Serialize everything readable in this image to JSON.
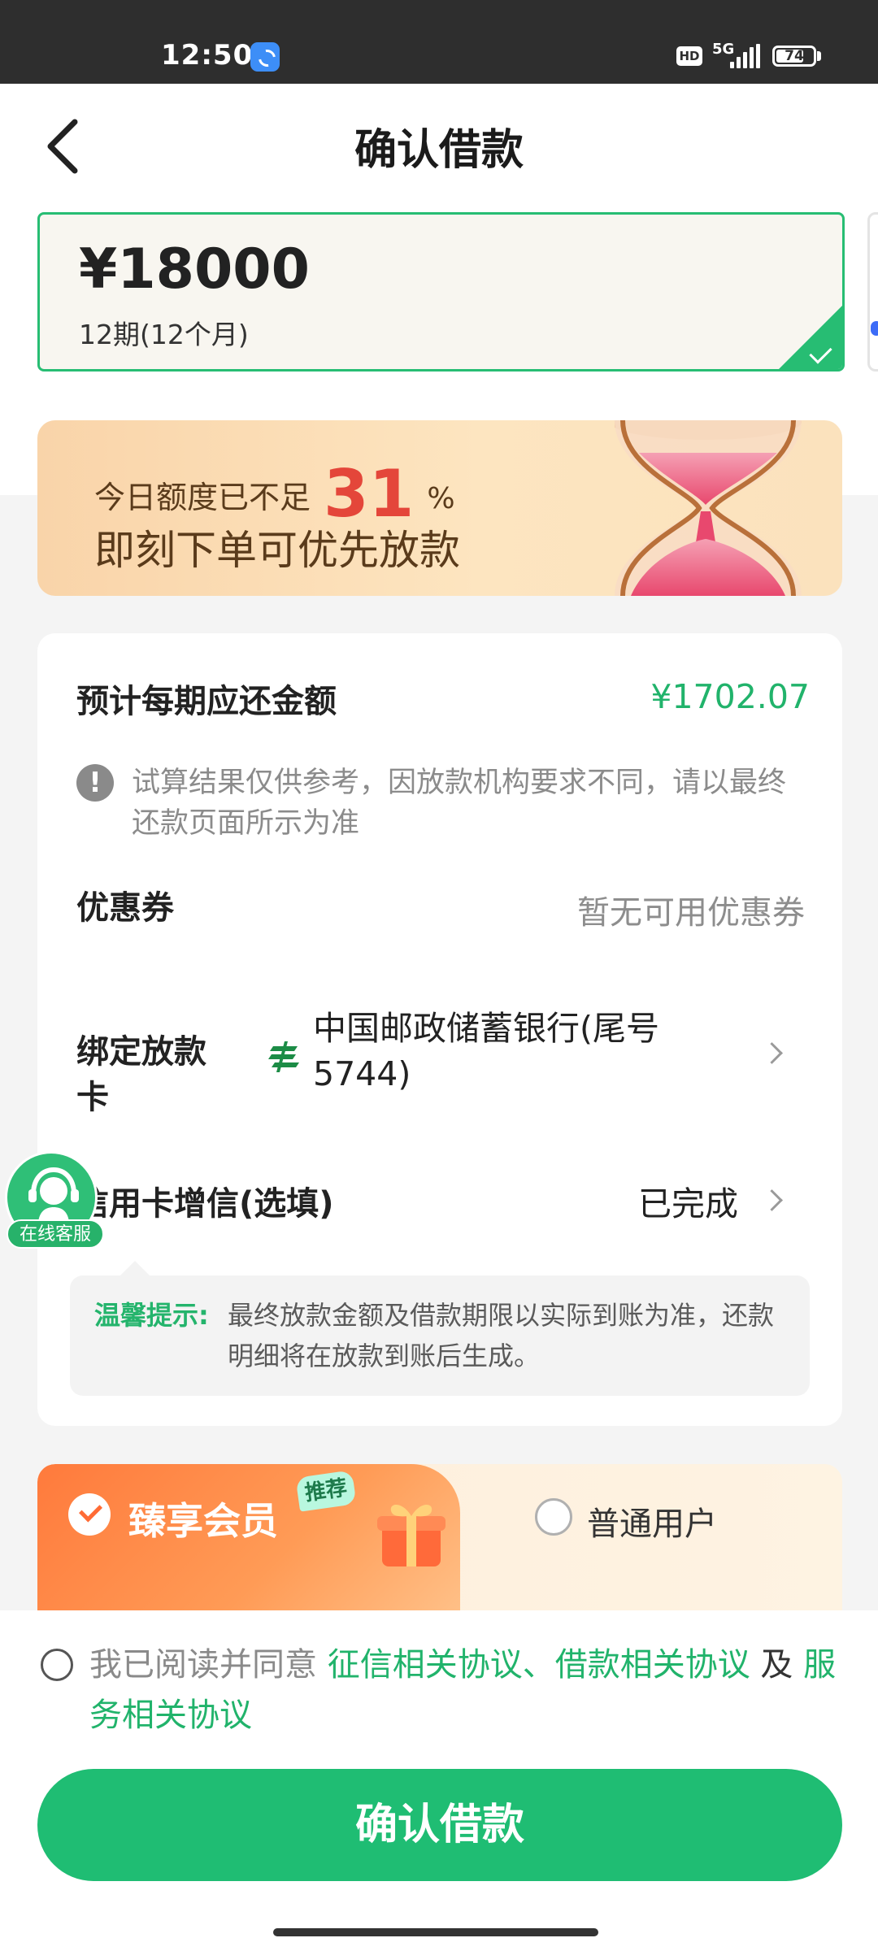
{
  "status_bar": {
    "time": "12:50",
    "network": "5G",
    "hd_label": "HD",
    "battery": "74",
    "battery_level": 0.74
  },
  "header": {
    "title": "确认借款"
  },
  "loan_option": {
    "amount": "¥18000",
    "term": "12期(12个月)"
  },
  "promo": {
    "prefix": "今日额度已不足",
    "percent_value": "31",
    "percent_sign": "%",
    "line2": "即刻下单可优先放款"
  },
  "details": {
    "repay_label": "预计每期应还金额",
    "repay_amount": "¥1702.07",
    "note": "试算结果仅供参考，因放款机构要求不同，请以最终还款页面所示为准",
    "coupon_label": "优惠券",
    "coupon_value": "暂无可用优惠券",
    "bank_label": "绑定放款卡",
    "bank_name": "中国邮政储蓄银行(尾号5744)",
    "credit_label": "信用卡增信(选填)",
    "credit_status": "已完成",
    "tips_label": "温馨提示:",
    "tips_text": "最终放款金额及借款期限以实际到账为准，还款明细将在放款到账后生成。"
  },
  "support": {
    "label": "在线客服"
  },
  "membership": {
    "vip_label": "臻享会员",
    "badge": "推荐",
    "normal_label": "普通用户"
  },
  "agreement": {
    "prefix": "我已阅读并同意 ",
    "link1": "征信相关协议、借款相关协议",
    "joiner": " 及 ",
    "link2": "服务相关协议"
  },
  "actions": {
    "confirm": "确认借款"
  },
  "colors": {
    "accent": "#1fbd73",
    "promo_number": "#e4463a"
  }
}
